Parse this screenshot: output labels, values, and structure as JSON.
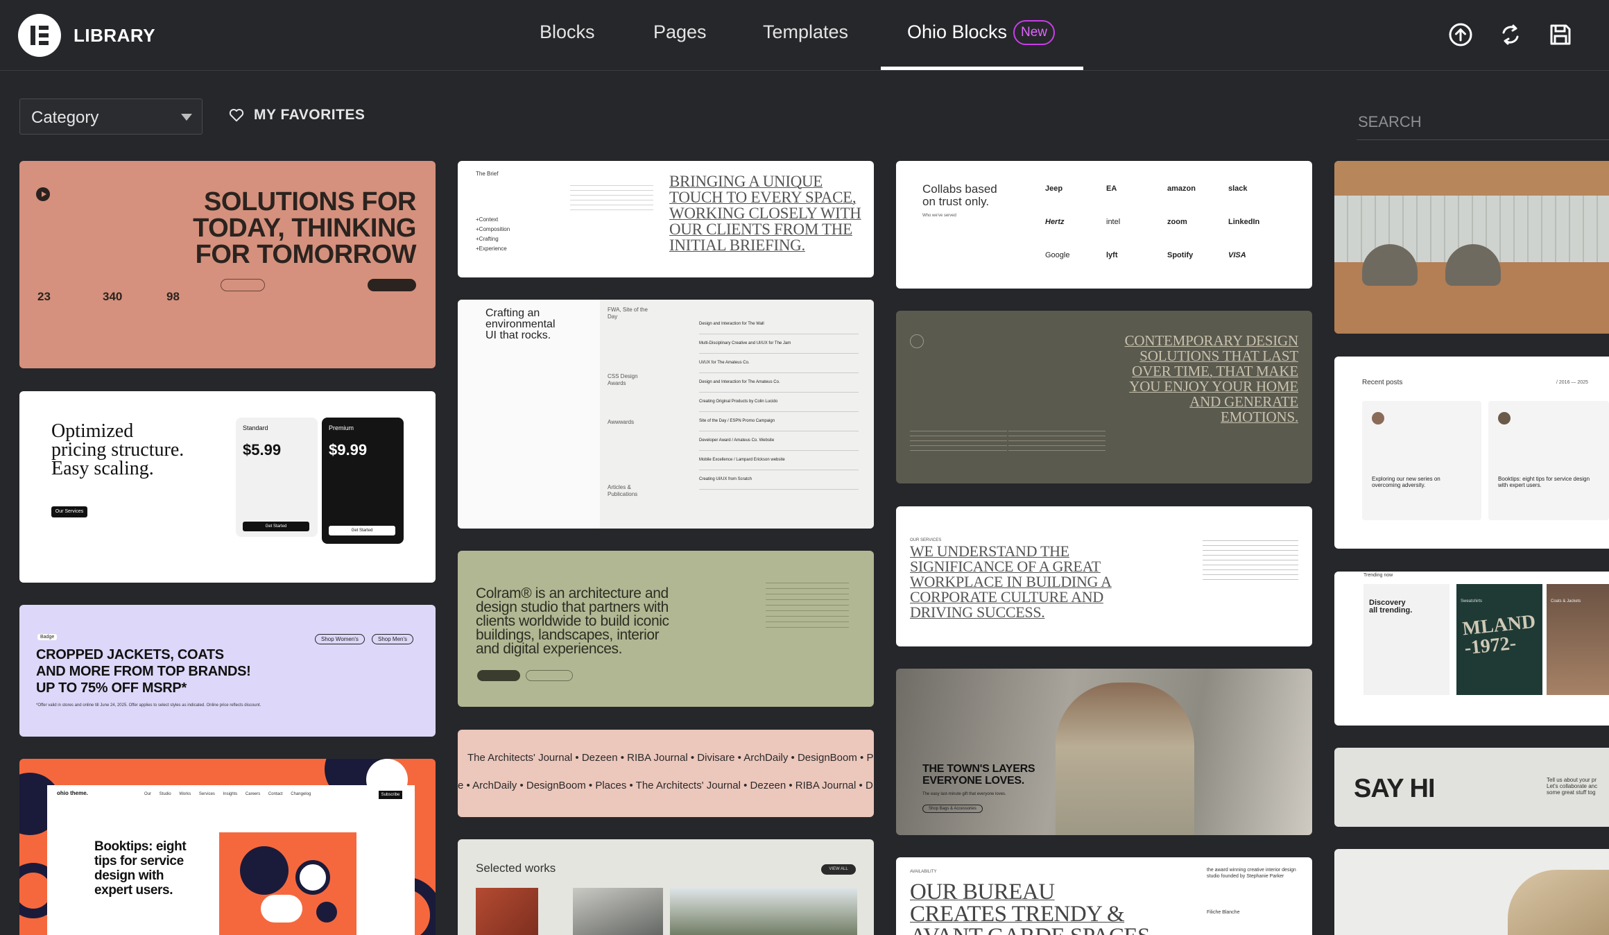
{
  "header": {
    "brand": "LIBRARY",
    "tabs": [
      {
        "label": "Blocks"
      },
      {
        "label": "Pages"
      },
      {
        "label": "Templates"
      },
      {
        "label": "Ohio Blocks",
        "badge": "New",
        "active": true
      }
    ],
    "icons": [
      "upload-icon",
      "sync-icon",
      "save-icon"
    ],
    "accent": "#c93de8"
  },
  "filters": {
    "category_label": "Category",
    "favorites_label": "MY FAVORITES",
    "search_placeholder": "SEARCH"
  },
  "cards": {
    "solutions": {
      "headline": [
        "SOLUTIONS FOR",
        "TODAY, THINKING",
        "FOR TOMORROW"
      ],
      "stats": [
        "23",
        "340",
        "98"
      ]
    },
    "pricing": {
      "headline": [
        "Optimized",
        "pricing structure.",
        "Easy scaling."
      ],
      "cta": "Our Services",
      "plans": [
        {
          "name": "Standard",
          "price": "$5.99",
          "button": "Get Started"
        },
        {
          "name": "Premium",
          "price": "$9.99",
          "button": "Get Started"
        }
      ]
    },
    "jackets": {
      "tag": "Badge",
      "headline": [
        "CROPPED JACKETS, COATS",
        "AND MORE FROM TOP BRANDS!",
        "UP TO 75% OFF MSRP*"
      ],
      "buttons": [
        "Shop Women's",
        "Shop Men's"
      ],
      "footnote": "*Offer valid in stores and online till June 24, 2025. Offer applies to select styles as indicated. Online price reflects discount."
    },
    "booktips": {
      "logo": "ohio theme.",
      "headline": [
        "Booktips: eight",
        "tips for service",
        "design with",
        "expert users."
      ],
      "menu": [
        "Our Studio",
        "Works",
        "Services",
        "Insights",
        "Careers",
        "Contact",
        "Changelog"
      ],
      "cta": "Subscribe"
    },
    "brief": {
      "label": "The Brief",
      "list": [
        "Context",
        "Composition",
        "Crafting",
        "Experience"
      ],
      "headline": [
        "BRINGING A UNIQUE",
        "TOUCH TO EVERY SPACE,",
        "WORKING CLOSELY WITH",
        "OUR CLIENTS FROM THE",
        "INITIAL BRIEFING."
      ]
    },
    "awards": {
      "headline": [
        "Crafting an",
        "environmental",
        "UI that rocks."
      ],
      "groups": [
        "FWA, Site of the Day",
        "CSS Design Awards",
        "Awwwards",
        "Articles & Publications"
      ],
      "rows": [
        "Design and Interaction for The Wall",
        "Multi-Disciplinary Creative and UI/UX for The Jam",
        "UI/UX for The Amateus Co.",
        "Design and Interaction for The Amateus Co.",
        "Creating Original Products by Colin Lucido",
        "Site of the Day / ESPN Promo Campaign",
        "Developer Award / Amateus Co. Website",
        "Mobile Excellence / Lampard Erickson website",
        "Creating UI/UX from Scratch"
      ]
    },
    "colram": {
      "headline": [
        "Colram® is an architecture and",
        "design studio that partners with",
        "clients worldwide to build iconic",
        "buildings, landscapes, interior",
        "and digital experiences."
      ]
    },
    "ticker": {
      "row1": "The Architects' Journal • Dezeen • RIBA Journal • Divisare • ArchDaily • DesignBoom • P",
      "row2": "e • ArchDaily • DesignBoom • Places • The Architects' Journal • Dezeen • RIBA Journal • D"
    },
    "selected": {
      "title": "Selected works",
      "cta": "VIEW ALL"
    },
    "collabs": {
      "headline": [
        "Collabs based",
        "on trust only."
      ],
      "sub": "Who we've served",
      "logos": [
        "Jeep",
        "EA",
        "amazon",
        "slack",
        "Hertz",
        "intel",
        "zoom",
        "LinkedIn",
        "Google",
        "lyft",
        "Spotify",
        "VISA"
      ]
    },
    "contemporary": {
      "headline": [
        "CONTEMPORARY DESIGN",
        "SOLUTIONS THAT LAST",
        "OVER TIME, THAT MAKE",
        "YOU ENJOY YOUR HOME",
        "AND GENERATE",
        "EMOTIONS."
      ]
    },
    "workplace": {
      "label": "OUR SERVICES",
      "headline": [
        "WE UNDERSTAND THE",
        "SIGNIFICANCE OF A GREAT",
        "WORKPLACE IN BUILDING A",
        "CORPORATE CULTURE AND",
        "DRIVING SUCCESS."
      ]
    },
    "townslayers": {
      "headline": [
        "THE TOWN'S LAYERS",
        "EVERYONE LOVES."
      ],
      "sub": "The easy last-minute gift that everyone loves.",
      "cta": "Shop Bags & Accessories"
    },
    "bureau": {
      "label": "AVAILABILITY",
      "headline": [
        "OUR BUREAU",
        "CREATES TRENDY &",
        "AVANT-GARDE SPACES"
      ],
      "note": "the award winning creative interior design studio founded by Stephanie Parker",
      "sign": "Filiche Blanche"
    },
    "recent": {
      "title": "Recent posts",
      "range": "/ 2016 — 2025",
      "posts": [
        {
          "title": "Exploring our new series on overcoming adversity."
        },
        {
          "title": "Booktips: eight tips for service design with expert users."
        }
      ]
    },
    "trending": {
      "label": "Trending now",
      "headline": [
        "Discovery",
        "all trending."
      ],
      "items": [
        "Sweatshirts",
        "Coats & Jackets"
      ],
      "print": [
        "MLAND",
        "-1972-"
      ]
    },
    "sayhi": {
      "headline": "SAY HI",
      "note": [
        "Tell us about your pr",
        "Let's collaborate anc",
        "some great stuff tog"
      ]
    }
  }
}
